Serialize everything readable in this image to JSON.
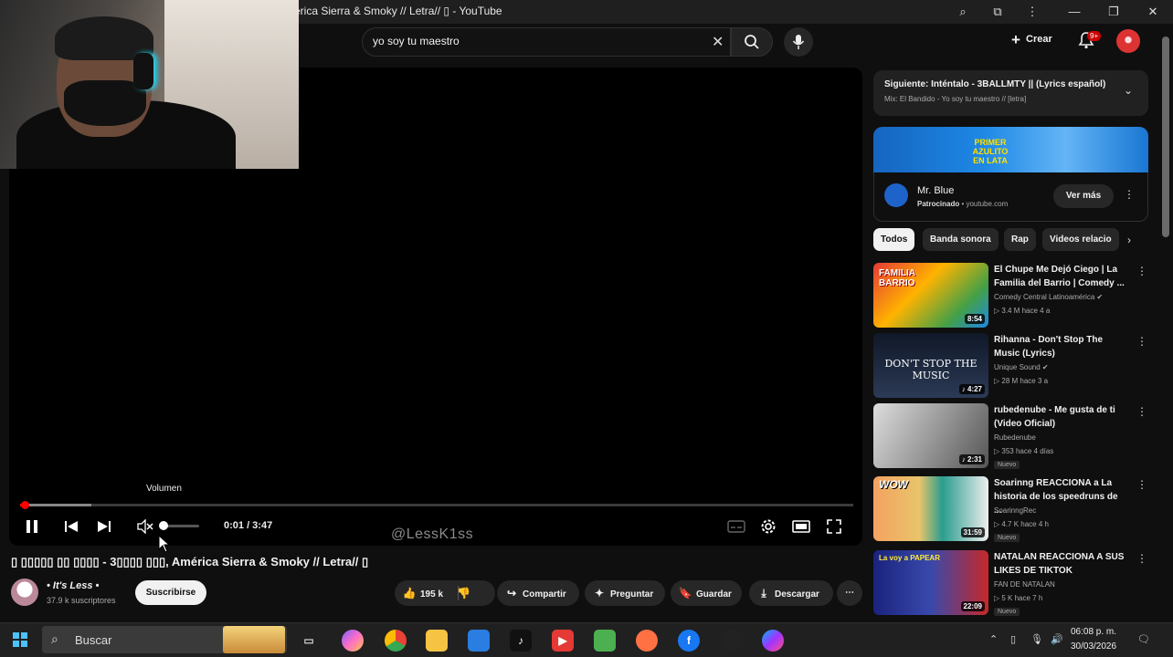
{
  "window": {
    "title": "érica Sierra & Smoky // Letra// ▯ - YouTube"
  },
  "header": {
    "search_value": "yo soy tu maestro",
    "create_label": "Crear",
    "notification_count": "9+"
  },
  "player": {
    "volume_tooltip": "Volumen",
    "time": "0:01 / 3:47",
    "watermark": "@LessK1ss",
    "progress_fraction": 0.001,
    "volume_fraction": 0.0
  },
  "video": {
    "title": "▯ ▯▯▯▯▯ ▯▯ ▯▯▯▯ - 3▯▯▯▯ ▯▯▯, América Sierra & Smoky // Letra// ▯",
    "channel_name": "• It's Less •",
    "channel_subs": "37.9 k suscriptores",
    "subscribe_label": "Suscribirse",
    "like_count": "195 k",
    "share_label": "Compartir",
    "ask_label": "Preguntar",
    "save_label": "Guardar",
    "download_label": "Descargar"
  },
  "sidebar": {
    "next_up_title": "Siguiente: Inténtalo - 3BALLMTY || (Lyrics español)",
    "next_up_sub": "Mix: El Bandido - Yo soy tu maestro // [letra]",
    "ad": {
      "banner_text": "PRIMER AZULITO EN LATA",
      "name": "Mr. Blue",
      "sponsor_label": "Patrocinado",
      "sponsor_domain": " • youtube.com",
      "button_label": "Ver más"
    },
    "chips": [
      "Todos",
      "Banda sonora",
      "Rap",
      "Videos relacio"
    ],
    "recommendations": [
      {
        "title": "El Chupe Me Dejó Ciego | La Familia del Barrio | Comedy ...",
        "channel": "Comedy Central Latinoamérica ✔",
        "meta": "▷ 3.4 M   hace 4 a",
        "duration": "8:54",
        "badge": ""
      },
      {
        "title": "Rihanna - Don't Stop The Music (Lyrics)",
        "channel": "Unique Sound ✔",
        "meta": "▷ 28 M   hace 3 a",
        "duration": "♪ 4:27",
        "badge": ""
      },
      {
        "title": "rubedenube - Me gusta de ti (Video Oficial)",
        "channel": "Rubedenube",
        "meta": "▷ 353   hace 4 días",
        "duration": "♪ 2:31",
        "badge": "Nuevo"
      },
      {
        "title": "Soarinng REACCIONA a La historia de los speedruns de ...",
        "channel": "SoarinngRec",
        "meta": "▷ 4.7 K   hace 4 h",
        "duration": "31:59",
        "badge": "Nuevo"
      },
      {
        "title": "NATALAN REACCIONA A SUS LIKES DE TIKTOK",
        "channel": "FAN DE NATALAN",
        "meta": "▷ 5 K   hace 7 h",
        "duration": "22:09",
        "badge": "Nuevo"
      }
    ]
  },
  "thumb_texts": {
    "t1": "FAMILIA BARRIO",
    "t2": "DON'T STOP THE MUSIC",
    "t4": "WOW",
    "t5": "La voy a PAPEAR"
  },
  "taskbar": {
    "search_label": "Buscar",
    "time": "06:08 p. m.",
    "date": "30/03/2026"
  }
}
